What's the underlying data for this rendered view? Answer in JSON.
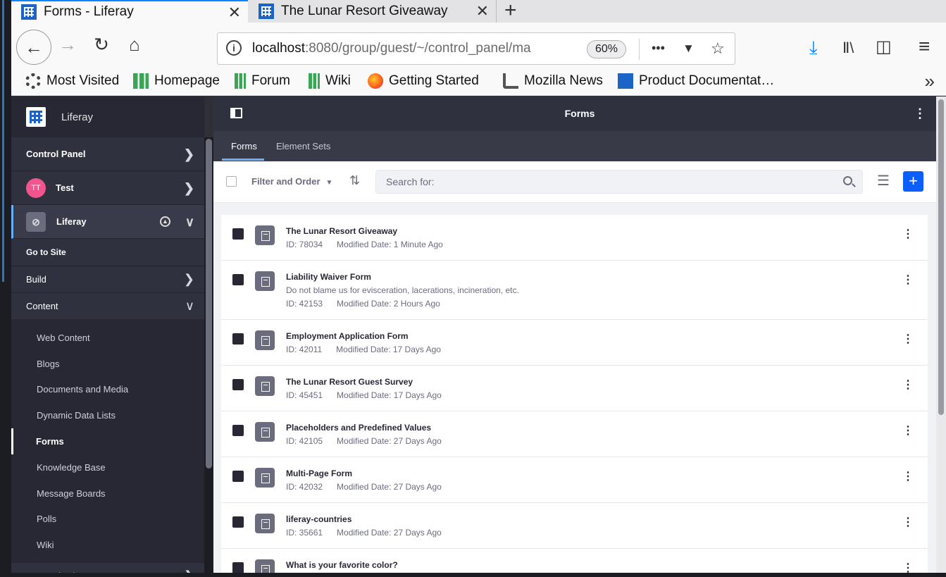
{
  "browser": {
    "tabs": [
      {
        "title": "Forms - Liferay",
        "active": true
      },
      {
        "title": "The Lunar Resort Giveaway",
        "active": false
      }
    ],
    "url_host": "localhost",
    "url_path": ":8080/group/guest/~/control_panel/ma",
    "zoom": "60%",
    "bookmarks": [
      "Most Visited",
      "Homepage",
      "Forum",
      "Wiki",
      "Getting Started",
      "Mozilla News",
      "Product Documentat…"
    ],
    "icons": {
      "back": "←",
      "forward": "→",
      "reload": "↻",
      "home": "⌂",
      "more": "•••",
      "pocket": "▼",
      "star": "☆",
      "download": "⤓",
      "library": "Ⅱ\\",
      "sidebar": "◫",
      "menu": "≡",
      "overflow": "»",
      "new_tab": "+",
      "close": "✕"
    }
  },
  "sidebar": {
    "title": "Liferay",
    "control_panel": "Control Panel",
    "user": {
      "initials": "TT",
      "name": "Test"
    },
    "site": {
      "icon": "⊘",
      "name": "Liferay"
    },
    "go_to_site": "Go to Site",
    "build": "Build",
    "content": "Content",
    "content_items": [
      "Web Content",
      "Blogs",
      "Documents and Media",
      "Dynamic Data Lists",
      "Forms",
      "Knowledge Base",
      "Message Boards",
      "Polls",
      "Wiki"
    ],
    "active_item": "Forms",
    "categorization": "Categorization",
    "chevron_right": "❯",
    "chevron_down": "∨"
  },
  "main": {
    "title": "Forms",
    "tabs": [
      "Forms",
      "Element Sets"
    ],
    "filter_label": "Filter and Order",
    "filter_caret": "▼",
    "sort_icon": "⇅",
    "search_placeholder": "Search for:",
    "list_icon": "☰",
    "add_icon": "+",
    "kebab": "⋮",
    "id_prefix": "ID: ",
    "date_prefix": "Modified Date: ",
    "rows": [
      {
        "title": "The Lunar Resort Giveaway",
        "desc": "",
        "id": "78034",
        "modified": "1 Minute Ago"
      },
      {
        "title": "Liability Waiver Form",
        "desc": "Do not blame us for evisceration, lacerations, incineration, etc.",
        "id": "42153",
        "modified": "2 Hours Ago"
      },
      {
        "title": "Employment Application Form",
        "desc": "",
        "id": "42011",
        "modified": "17 Days Ago"
      },
      {
        "title": "The Lunar Resort Guest Survey",
        "desc": "",
        "id": "45451",
        "modified": "17 Days Ago"
      },
      {
        "title": "Placeholders and Predefined Values",
        "desc": "",
        "id": "42105",
        "modified": "27 Days Ago"
      },
      {
        "title": "Multi-Page Form",
        "desc": "",
        "id": "42032",
        "modified": "27 Days Ago"
      },
      {
        "title": "liferay-countries",
        "desc": "",
        "id": "35661",
        "modified": "27 Days Ago"
      },
      {
        "title": "What is your favorite color?",
        "desc": "",
        "id": "",
        "modified": ""
      }
    ]
  }
}
